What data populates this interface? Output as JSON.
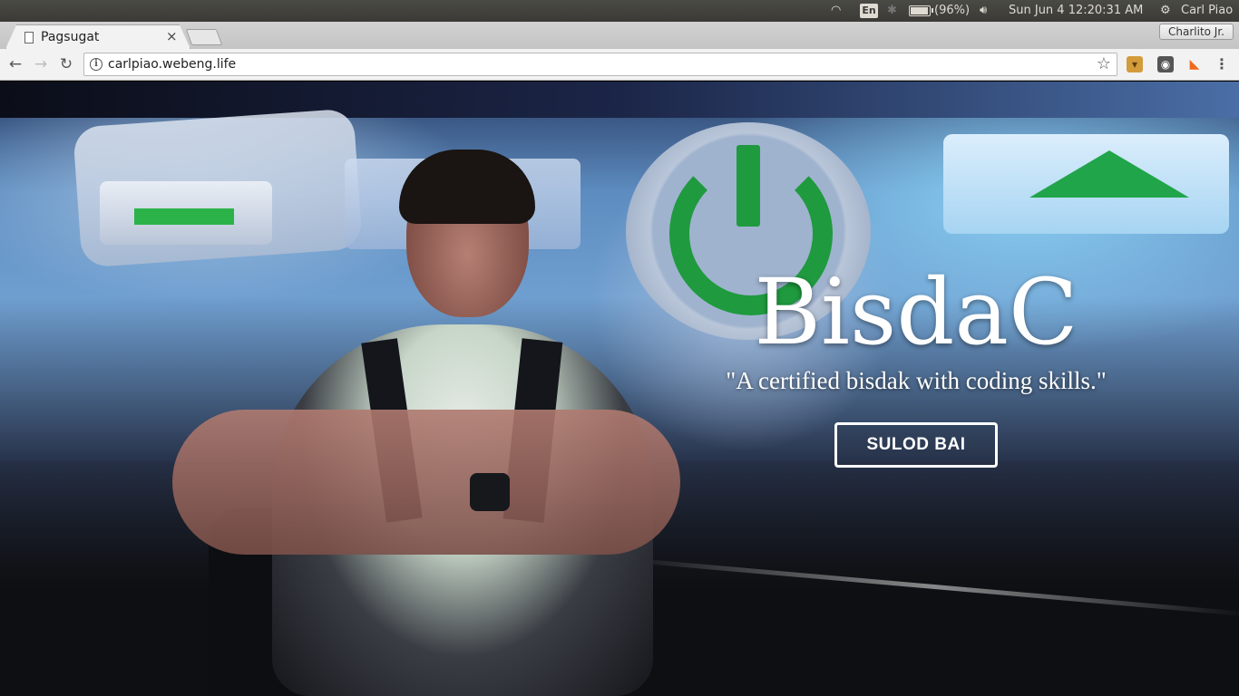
{
  "system_panel": {
    "language": "En",
    "battery": "(96%)",
    "datetime": "Sun Jun  4 12:20:31 AM",
    "user": "Carl Piao"
  },
  "browser": {
    "tab_title": "Pagsugat",
    "tab_close": "×",
    "profile_name": "Charlito Jr.",
    "url": "carlpiao.webeng.life"
  },
  "hero": {
    "title": "BisdaC",
    "subtitle": "\"A certified bisdak with coding skills.\"",
    "button_label": "SULOD BAI"
  },
  "icons": {
    "wifi": "wifi-icon",
    "bluetooth": "bluetooth-icon",
    "volume": "volume-icon",
    "power": "power-icon",
    "back": "back-arrow-icon",
    "forward": "forward-arrow-icon",
    "reload": "reload-icon",
    "info": "info-icon",
    "star": "bookmark-star-icon",
    "menu": "menu-dots-icon"
  }
}
